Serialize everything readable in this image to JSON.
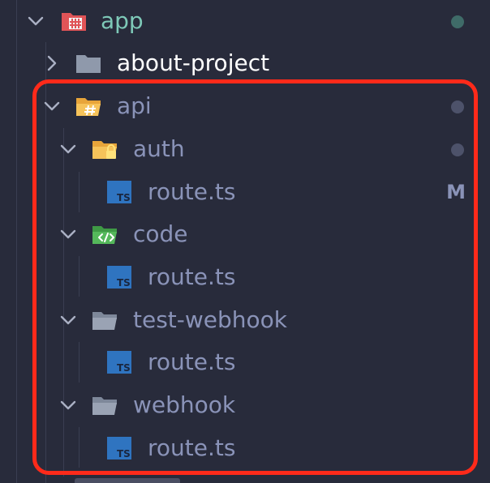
{
  "colors": {
    "background": "#282b3b",
    "guide_line": "#3a3e52",
    "chevron": "#aab0c4",
    "app_label": "#7ec9b8",
    "folder_label_bright": "#ffffff",
    "folder_label_dim": "#8a93b8",
    "file_label": "#8a93b8",
    "status_modified": "#8a93b8",
    "dot_teal": "#3f6b68",
    "dot_muted": "#4d526a",
    "highlight": "#ff2a1a",
    "ts_blue": "#2f74c0"
  },
  "tree": [
    {
      "label": "app",
      "type": "folder",
      "expanded": true,
      "icon": "app-folder-icon",
      "status": "",
      "dot": "teal"
    },
    {
      "label": "about-project",
      "type": "folder",
      "expanded": false,
      "icon": "folder-icon",
      "status": "",
      "dot": ""
    },
    {
      "label": "api",
      "type": "folder",
      "expanded": true,
      "icon": "api-folder-icon",
      "status": "",
      "dot": "muted"
    },
    {
      "label": "auth",
      "type": "folder",
      "expanded": true,
      "icon": "auth-folder-lock-icon",
      "status": "",
      "dot": "muted"
    },
    {
      "label": "route.ts",
      "type": "file",
      "icon": "typescript-file-icon",
      "status": "M",
      "dot": ""
    },
    {
      "label": "code",
      "type": "folder",
      "expanded": true,
      "icon": "code-folder-icon",
      "status": "",
      "dot": ""
    },
    {
      "label": "route.ts",
      "type": "file",
      "icon": "typescript-file-icon",
      "status": "",
      "dot": ""
    },
    {
      "label": "test-webhook",
      "type": "folder",
      "expanded": true,
      "icon": "folder-open-icon",
      "status": "",
      "dot": ""
    },
    {
      "label": "route.ts",
      "type": "file",
      "icon": "typescript-file-icon",
      "status": "",
      "dot": ""
    },
    {
      "label": "webhook",
      "type": "folder",
      "expanded": true,
      "icon": "folder-open-icon",
      "status": "",
      "dot": ""
    },
    {
      "label": "route.ts",
      "type": "file",
      "icon": "typescript-file-icon",
      "status": "",
      "dot": ""
    }
  ]
}
